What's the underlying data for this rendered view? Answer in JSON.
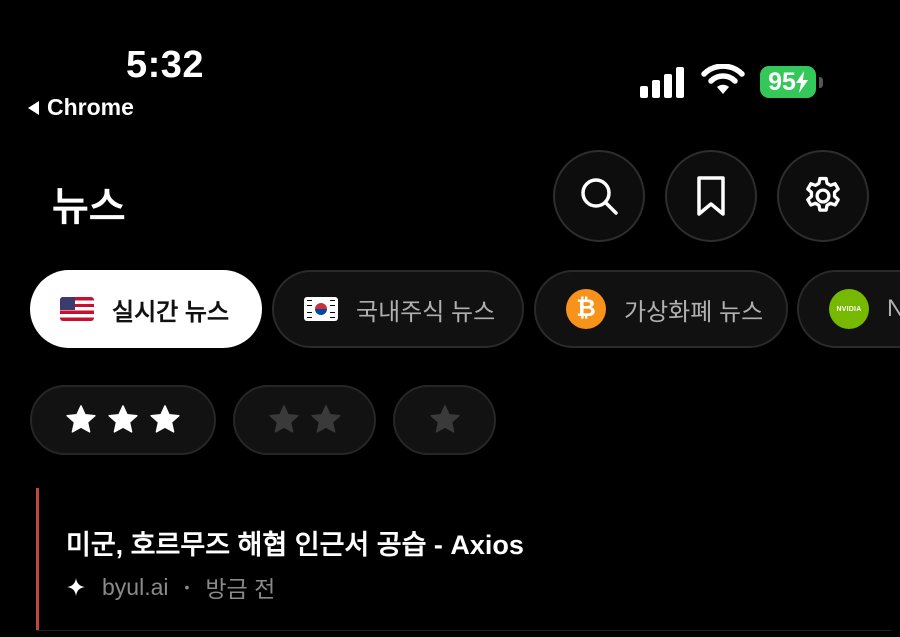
{
  "status_bar": {
    "time": "5:32",
    "back_app": "Chrome",
    "battery": "95"
  },
  "header": {
    "title": "뉴스",
    "icons": [
      "search-icon",
      "bookmark-icon",
      "gear-icon"
    ]
  },
  "categories": [
    {
      "label": "실시간 뉴스",
      "icon": "us-flag",
      "active": true
    },
    {
      "label": "국내주식 뉴스",
      "icon": "korea-flag",
      "active": false
    },
    {
      "label": "가상화폐 뉴스",
      "icon": "bitcoin",
      "active": false
    },
    {
      "label": "N",
      "icon": "nvidia-logo",
      "icon_text": "NVIDIA",
      "active": false
    }
  ],
  "star_filters": [
    {
      "stars": 3,
      "active": true
    },
    {
      "stars": 2,
      "active": false
    },
    {
      "stars": 1,
      "active": false
    }
  ],
  "news": [
    {
      "title": "미군, 호르무즈 해협 인근서 공습 - Axios",
      "source": "byul.ai",
      "separator": "•",
      "time": "방금 전"
    }
  ],
  "colors": {
    "battery": "#34c759",
    "accent_bar": "#c0473c",
    "bitcoin": "#f7931a",
    "nvidia": "#76b900"
  }
}
